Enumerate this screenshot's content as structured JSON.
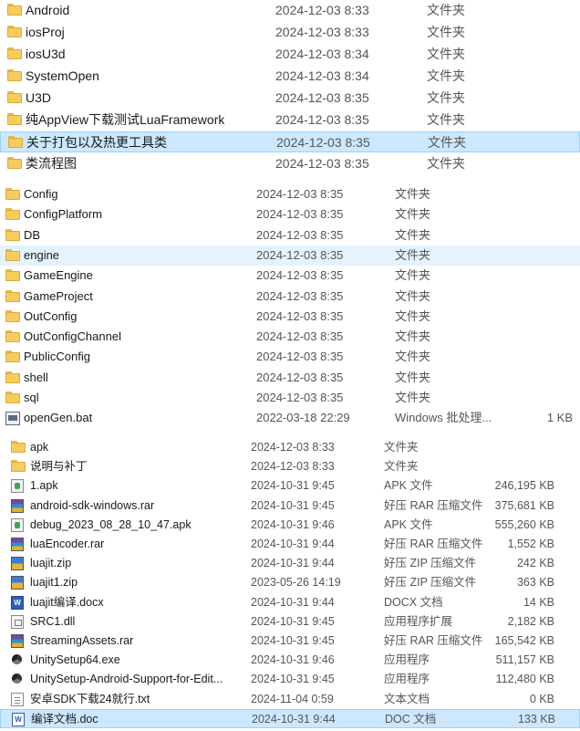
{
  "section1": {
    "rows": [
      {
        "name": "Android",
        "date": "2024-12-03 8:33",
        "type": "文件夹",
        "icon": "folder-icon"
      },
      {
        "name": "iosProj",
        "date": "2024-12-03 8:33",
        "type": "文件夹",
        "icon": "folder-icon"
      },
      {
        "name": "iosU3d",
        "date": "2024-12-03 8:34",
        "type": "文件夹",
        "icon": "folder-icon"
      },
      {
        "name": "SystemOpen",
        "date": "2024-12-03 8:34",
        "type": "文件夹",
        "icon": "folder-icon"
      },
      {
        "name": "U3D",
        "date": "2024-12-03 8:35",
        "type": "文件夹",
        "icon": "folder-icon"
      },
      {
        "name": "纯AppView下载测试LuaFramework",
        "date": "2024-12-03 8:35",
        "type": "文件夹",
        "icon": "folder-icon"
      },
      {
        "name": "关于打包以及热更工具类",
        "date": "2024-12-03 8:35",
        "type": "文件夹",
        "icon": "folder-icon"
      },
      {
        "name": "类流程图",
        "date": "2024-12-03 8:35",
        "type": "文件夹",
        "icon": "folder-icon"
      }
    ]
  },
  "section2": {
    "rows": [
      {
        "name": "Config",
        "date": "2024-12-03 8:35",
        "type": "文件夹",
        "size": "",
        "icon": "folder-icon"
      },
      {
        "name": "ConfigPlatform",
        "date": "2024-12-03 8:35",
        "type": "文件夹",
        "size": "",
        "icon": "folder-icon"
      },
      {
        "name": "DB",
        "date": "2024-12-03 8:35",
        "type": "文件夹",
        "size": "",
        "icon": "folder-icon"
      },
      {
        "name": "engine",
        "date": "2024-12-03 8:35",
        "type": "文件夹",
        "size": "",
        "icon": "folder-icon"
      },
      {
        "name": "GameEngine",
        "date": "2024-12-03 8:35",
        "type": "文件夹",
        "size": "",
        "icon": "folder-icon"
      },
      {
        "name": "GameProject",
        "date": "2024-12-03 8:35",
        "type": "文件夹",
        "size": "",
        "icon": "folder-icon"
      },
      {
        "name": "OutConfig",
        "date": "2024-12-03 8:35",
        "type": "文件夹",
        "size": "",
        "icon": "folder-icon"
      },
      {
        "name": "OutConfigChannel",
        "date": "2024-12-03 8:35",
        "type": "文件夹",
        "size": "",
        "icon": "folder-icon"
      },
      {
        "name": "PublicConfig",
        "date": "2024-12-03 8:35",
        "type": "文件夹",
        "size": "",
        "icon": "folder-icon"
      },
      {
        "name": "shell",
        "date": "2024-12-03 8:35",
        "type": "文件夹",
        "size": "",
        "icon": "folder-icon"
      },
      {
        "name": "sql",
        "date": "2024-12-03 8:35",
        "type": "文件夹",
        "size": "",
        "icon": "folder-icon"
      },
      {
        "name": "openGen.bat",
        "date": "2022-03-18 22:29",
        "type": "Windows 批处理...",
        "size": "1 KB",
        "icon": "bat-file-icon"
      }
    ]
  },
  "section3": {
    "rows": [
      {
        "name": "apk",
        "date": "2024-12-03 8:33",
        "type": "文件夹",
        "size": "",
        "icon": "folder-icon"
      },
      {
        "name": "说明与补丁",
        "date": "2024-12-03 8:33",
        "type": "文件夹",
        "size": "",
        "icon": "folder-icon"
      },
      {
        "name": "1.apk",
        "date": "2024-10-31 9:45",
        "type": "APK 文件",
        "size": "246,195 KB",
        "icon": "apk-file-icon"
      },
      {
        "name": "android-sdk-windows.rar",
        "date": "2024-10-31 9:45",
        "type": "好压 RAR 压缩文件",
        "size": "375,681 KB",
        "icon": "rar-archive-icon"
      },
      {
        "name": "debug_2023_08_28_10_47.apk",
        "date": "2024-10-31 9:46",
        "type": "APK 文件",
        "size": "555,260 KB",
        "icon": "apk-file-icon"
      },
      {
        "name": "luaEncoder.rar",
        "date": "2024-10-31 9:44",
        "type": "好压 RAR 压缩文件",
        "size": "1,552 KB",
        "icon": "rar-archive-icon"
      },
      {
        "name": "luajit.zip",
        "date": "2024-10-31 9:44",
        "type": "好压 ZIP 压缩文件",
        "size": "242 KB",
        "icon": "zip-archive-icon"
      },
      {
        "name": "luajit1.zip",
        "date": "2023-05-26 14:19",
        "type": "好压 ZIP 压缩文件",
        "size": "363 KB",
        "icon": "zip-archive-icon"
      },
      {
        "name": "luajit编译.docx",
        "date": "2024-10-31 9:44",
        "type": "DOCX 文档",
        "size": "14 KB",
        "icon": "word-document-icon"
      },
      {
        "name": "SRC1.dll",
        "date": "2024-10-31 9:45",
        "type": "应用程序扩展",
        "size": "2,182 KB",
        "icon": "dll-file-icon"
      },
      {
        "name": "StreamingAssets.rar",
        "date": "2024-10-31 9:45",
        "type": "好压 RAR 压缩文件",
        "size": "165,542 KB",
        "icon": "rar-archive-icon"
      },
      {
        "name": "UnitySetup64.exe",
        "date": "2024-10-31 9:46",
        "type": "应用程序",
        "size": "511,157 KB",
        "icon": "unity-exe-icon"
      },
      {
        "name": "UnitySetup-Android-Support-for-Edit...",
        "date": "2024-10-31 9:45",
        "type": "应用程序",
        "size": "112,480 KB",
        "icon": "unity-exe-icon"
      },
      {
        "name": "安卓SDK下载24就行.txt",
        "date": "2024-11-04 0:59",
        "type": "文本文档",
        "size": "0 KB",
        "icon": "text-file-icon"
      },
      {
        "name": "编译文档.doc",
        "date": "2024-10-31 9:44",
        "type": "DOC 文档",
        "size": "133 KB",
        "icon": "word-document-icon"
      }
    ]
  },
  "colors": {
    "selection": "#cce8ff",
    "selection_border": "#99d1ff",
    "hover": "#e5f3ff",
    "folder": "#f6cd5c"
  }
}
